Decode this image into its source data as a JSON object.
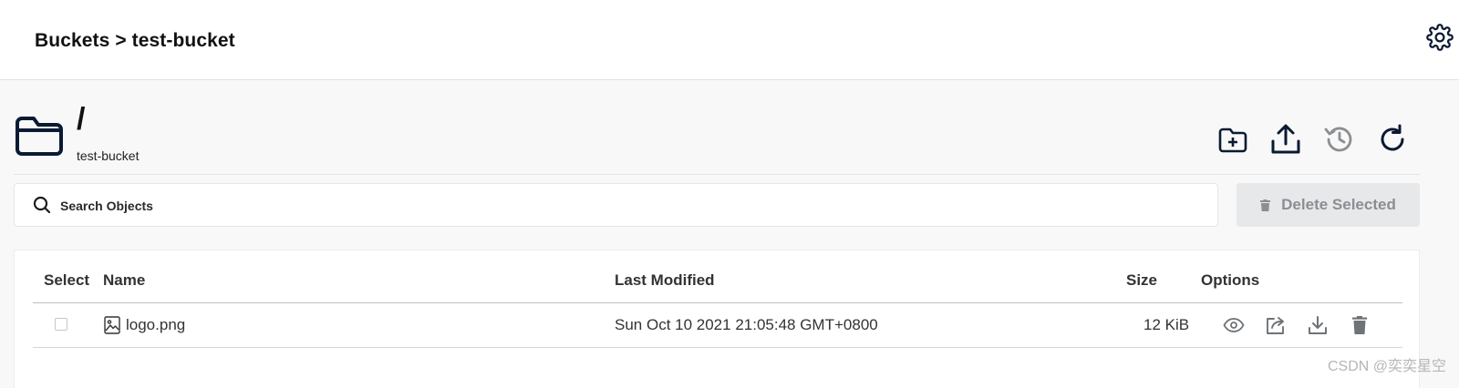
{
  "header": {
    "breadcrumb": "Buckets > test-bucket",
    "settings_icon": "gear-icon"
  },
  "path": {
    "title": "/",
    "bucket_name": "test-bucket",
    "folder_icon": "folder-icon"
  },
  "toolbar": {
    "actions": [
      {
        "name": "create-folder-button",
        "icon": "folder-plus-icon"
      },
      {
        "name": "upload-button",
        "icon": "upload-icon"
      },
      {
        "name": "rewind-button",
        "icon": "history-icon",
        "disabled": true
      },
      {
        "name": "refresh-button",
        "icon": "refresh-icon"
      }
    ]
  },
  "search": {
    "placeholder": "Search Objects",
    "value": ""
  },
  "delete_selected": {
    "label": "Delete Selected",
    "icon": "trash-icon",
    "disabled": true
  },
  "table": {
    "columns": [
      "Select",
      "Name",
      "Last Modified",
      "Size",
      "Options"
    ],
    "rows": [
      {
        "selected": false,
        "name": "logo.png",
        "type_icon": "image-file-icon",
        "last_modified": "Sun Oct 10 2021 21:05:48 GMT+0800",
        "size": "12 KiB",
        "options": [
          "preview-icon",
          "share-icon",
          "download-icon",
          "delete-icon"
        ]
      }
    ]
  },
  "watermark": "CSDN @奕奕星空",
  "colors": {
    "icon_dark": "#0b1a33",
    "icon_disabled": "#8b8f93",
    "option_icon": "#6f7377",
    "page_bg": "#f8f8f8"
  }
}
